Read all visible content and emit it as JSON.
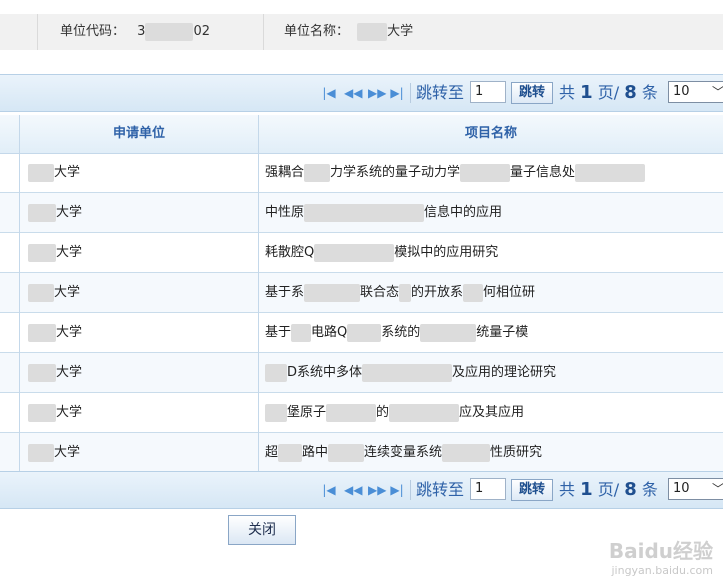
{
  "info": {
    "code_label": "单位代码：",
    "code_value_prefix": "3",
    "code_value_suffix": "02",
    "name_label": "单位名称：",
    "name_value_suffix": "大学"
  },
  "pager": {
    "jump_label": "跳转至",
    "page_value": "1",
    "go_button": "跳转",
    "total_prefix": "共",
    "total_pages": "1",
    "page_unit": "页/",
    "total_records": "8",
    "record_unit": "条",
    "page_size": "10",
    "icons": [
      "first-page-icon",
      "prev-page-icon",
      "next-page-icon",
      "last-page-icon"
    ]
  },
  "table": {
    "columns": [
      "申请单位",
      "项目名称"
    ],
    "rows": [
      {
        "unit": "大学",
        "project": [
          "强耦合",
          "力学系统的量子动力学",
          "量子信息处"
        ]
      },
      {
        "unit": "大学",
        "project": [
          "中性原",
          "信息中的应用"
        ]
      },
      {
        "unit": "大学",
        "project": [
          "耗散腔Q",
          "模拟中的应用研究"
        ]
      },
      {
        "unit": "大学",
        "project": [
          "基于系",
          "联合态",
          "的开放系",
          "何相位研"
        ]
      },
      {
        "unit": "大学",
        "project": [
          "基于",
          "电路Q",
          "系统的",
          "统量子模"
        ]
      },
      {
        "unit": "大学",
        "project": [
          "",
          "D系统中多体",
          "及应用的理论研究"
        ]
      },
      {
        "unit": "大学",
        "project": [
          "",
          "堡原子",
          "的",
          "应及其应用"
        ]
      },
      {
        "unit": "大学",
        "project": [
          "超",
          "路中",
          "连续变量系统",
          "性质研究"
        ]
      }
    ]
  },
  "close_button": "关闭",
  "watermark": {
    "brand": "Baidu经验",
    "url": "jingyan.baidu.com"
  },
  "colors": {
    "accent": "#2f62a8",
    "pager_bg": "#d6e7f5",
    "row_border": "#c9dceb"
  }
}
